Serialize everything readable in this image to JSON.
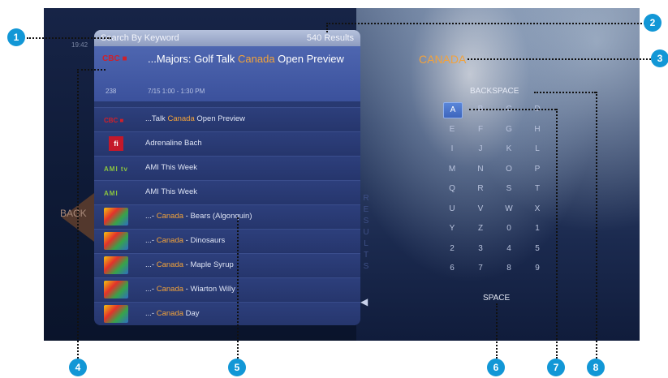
{
  "search": {
    "keyword_label": "Search By Keyword",
    "results_count": "540 Results"
  },
  "clock": "19:42",
  "selected": {
    "logo": "CBC ■",
    "title_prefix": "...Majors: Golf Talk ",
    "title_highlight": "Canada",
    "title_suffix": " Open Preview",
    "channel": "238",
    "time": "7/15  1:00 - 1:30 PM"
  },
  "results": [
    {
      "logo_type": "txt",
      "logo": "CBC ■",
      "prefix": "...Talk ",
      "highlight": "Canada",
      "suffix": " Open Preview"
    },
    {
      "logo_type": "fi",
      "logo": "fi",
      "prefix": "Adrenaline Bach",
      "highlight": "",
      "suffix": ""
    },
    {
      "logo_type": "ami",
      "logo": "AMI tv",
      "prefix": "AMI This Week",
      "highlight": "",
      "suffix": ""
    },
    {
      "logo_type": "ami",
      "logo": "AMI audio",
      "prefix": "AMI This Week",
      "highlight": "",
      "suffix": ""
    },
    {
      "logo_type": "tile",
      "logo": "",
      "prefix": "...- ",
      "highlight": "Canada",
      "suffix": " - Bears (Algonquin)"
    },
    {
      "logo_type": "tile",
      "logo": "",
      "prefix": "...- ",
      "highlight": "Canada",
      "suffix": " - Dinosaurs"
    },
    {
      "logo_type": "tile",
      "logo": "",
      "prefix": "...- ",
      "highlight": "Canada",
      "suffix": " - Maple Syrup"
    },
    {
      "logo_type": "tile",
      "logo": "",
      "prefix": "...- ",
      "highlight": "Canada",
      "suffix": " - Wiarton Willy"
    },
    {
      "logo_type": "tile",
      "logo": "",
      "prefix": "...- ",
      "highlight": "Canada",
      "suffix": " Day"
    }
  ],
  "results_vertical_label": "RESULTS",
  "back_label": "BACK",
  "query": "CANADA",
  "keyboard": {
    "backspace": "BACKSPACE",
    "space": "SPACE",
    "active_key": "A",
    "rows": [
      [
        "A",
        "B",
        "C",
        "D"
      ],
      [
        "E",
        "F",
        "G",
        "H"
      ],
      [
        "I",
        "J",
        "K",
        "L"
      ],
      [
        "M",
        "N",
        "O",
        "P"
      ],
      [
        "Q",
        "R",
        "S",
        "T"
      ],
      [
        "U",
        "V",
        "W",
        "X"
      ],
      [
        "Y",
        "Z",
        "0",
        "1"
      ],
      [
        "2",
        "3",
        "4",
        "5"
      ],
      [
        "6",
        "7",
        "8",
        "9"
      ]
    ]
  },
  "callouts": [
    "1",
    "2",
    "3",
    "4",
    "5",
    "6",
    "7",
    "8"
  ],
  "colors": {
    "highlight": "#f3a33a",
    "callout": "#1297d6",
    "active_key": "#4a74cc"
  }
}
